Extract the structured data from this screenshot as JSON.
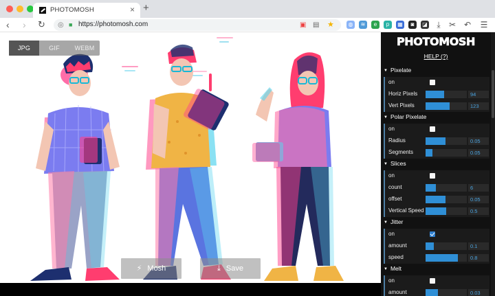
{
  "browser": {
    "tab_title": "PHOTOMOSH",
    "tab_close": "×",
    "new_tab": "+",
    "url": "https://photomosh.com",
    "nav": {
      "back": "‹",
      "forward": "›",
      "reload": "↻"
    }
  },
  "canvas": {
    "formats": [
      "JPG",
      "GIF",
      "WEBM"
    ],
    "selected_format": "JPG",
    "mosh_label": "Mosh",
    "save_label": "Save"
  },
  "panel": {
    "logo": "PHOTOMOSH",
    "help": "HELP (?)",
    "sections": [
      {
        "title": "Pixelate",
        "rows": [
          {
            "label": "on",
            "kind": "check",
            "checked": false
          },
          {
            "label": "Horiz Pixels",
            "kind": "slider",
            "value": "94",
            "fill": 0.45
          },
          {
            "label": "Vert Pixels",
            "kind": "slider",
            "value": "123",
            "fill": 0.58
          }
        ]
      },
      {
        "title": "Polar Pixelate",
        "rows": [
          {
            "label": "on",
            "kind": "check",
            "checked": false
          },
          {
            "label": "Radius",
            "kind": "slider",
            "value": "0.05",
            "fill": 0.48
          },
          {
            "label": "Segments",
            "kind": "slider",
            "value": "0.05",
            "fill": 0.16
          }
        ]
      },
      {
        "title": "Slices",
        "rows": [
          {
            "label": "on",
            "kind": "check",
            "checked": false
          },
          {
            "label": "count",
            "kind": "slider",
            "value": "6",
            "fill": 0.25
          },
          {
            "label": "offset",
            "kind": "slider",
            "value": "0.05",
            "fill": 0.48
          },
          {
            "label": "Vertical Speed",
            "kind": "slider",
            "value": "0.5",
            "fill": 0.5
          }
        ]
      },
      {
        "title": "Jitter",
        "rows": [
          {
            "label": "on",
            "kind": "check",
            "checked": true
          },
          {
            "label": "amount",
            "kind": "slider",
            "value": "0.1",
            "fill": 0.2
          },
          {
            "label": "speed",
            "kind": "slider",
            "value": "0.8",
            "fill": 0.78
          }
        ]
      },
      {
        "title": "Melt",
        "rows": [
          {
            "label": "on",
            "kind": "check",
            "checked": false
          },
          {
            "label": "amount",
            "kind": "slider",
            "value": "0.03",
            "fill": 0.3
          }
        ]
      }
    ]
  },
  "colors": {
    "accent": "#2f8fd6",
    "row_marker": "#4d7fa6",
    "panel_bg": "#111111",
    "glitch_pink": "#ff3d8b",
    "glitch_cyan": "#33d6f5"
  },
  "icons": {
    "mosh": "lightning-icon",
    "save": "download-icon",
    "secure": "lock-icon"
  }
}
